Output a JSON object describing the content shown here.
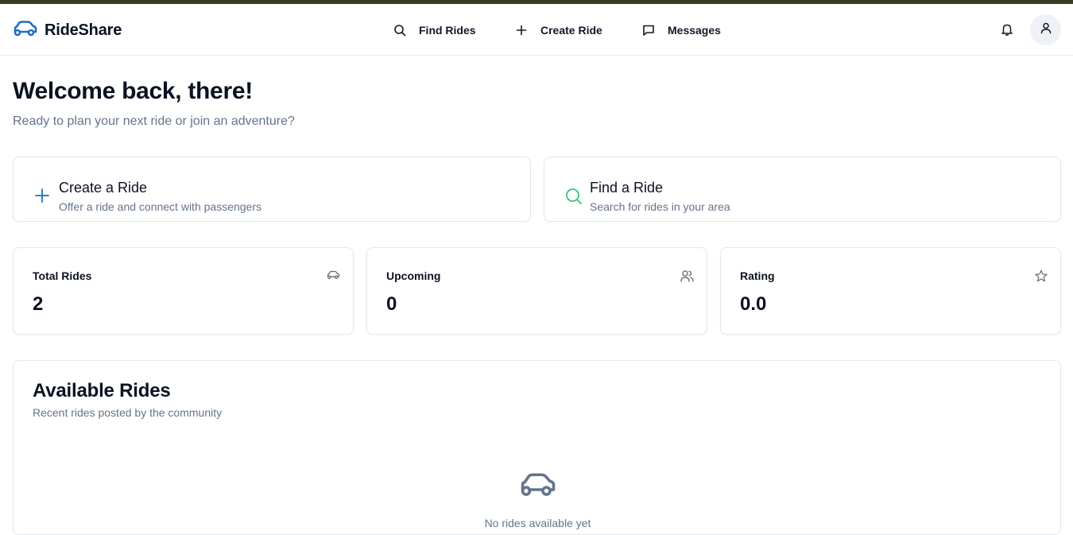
{
  "app": {
    "brand": "RideShare",
    "brand_icon": "car-icon",
    "accent_color": "#1d6fc4"
  },
  "nav": {
    "items": [
      {
        "label": "Find Rides",
        "icon": "search-icon"
      },
      {
        "label": "Create Ride",
        "icon": "plus-icon"
      },
      {
        "label": "Messages",
        "icon": "message-icon"
      }
    ],
    "notifications_icon": "bell-icon",
    "avatar_icon": "user-icon"
  },
  "welcome": {
    "title": "Welcome back, there!",
    "subtitle": "Ready to plan your next ride or join an adventure?"
  },
  "actions": [
    {
      "title": "Create a Ride",
      "subtitle": "Offer a ride and connect with passengers",
      "icon": "plus-icon",
      "icon_color": "#1d6fc4"
    },
    {
      "title": "Find a Ride",
      "subtitle": "Search for rides in your area",
      "icon": "search-icon",
      "icon_color": "#34c77b"
    }
  ],
  "stats": [
    {
      "label": "Total Rides",
      "value": "2",
      "icon": "car-icon"
    },
    {
      "label": "Upcoming",
      "value": "0",
      "icon": "users-icon"
    },
    {
      "label": "Rating",
      "value": "0.0",
      "icon": "star-icon"
    }
  ],
  "available_rides": {
    "title": "Available Rides",
    "subtitle": "Recent rides posted by the community",
    "empty_icon": "car-icon",
    "empty_text": "No rides available yet"
  }
}
